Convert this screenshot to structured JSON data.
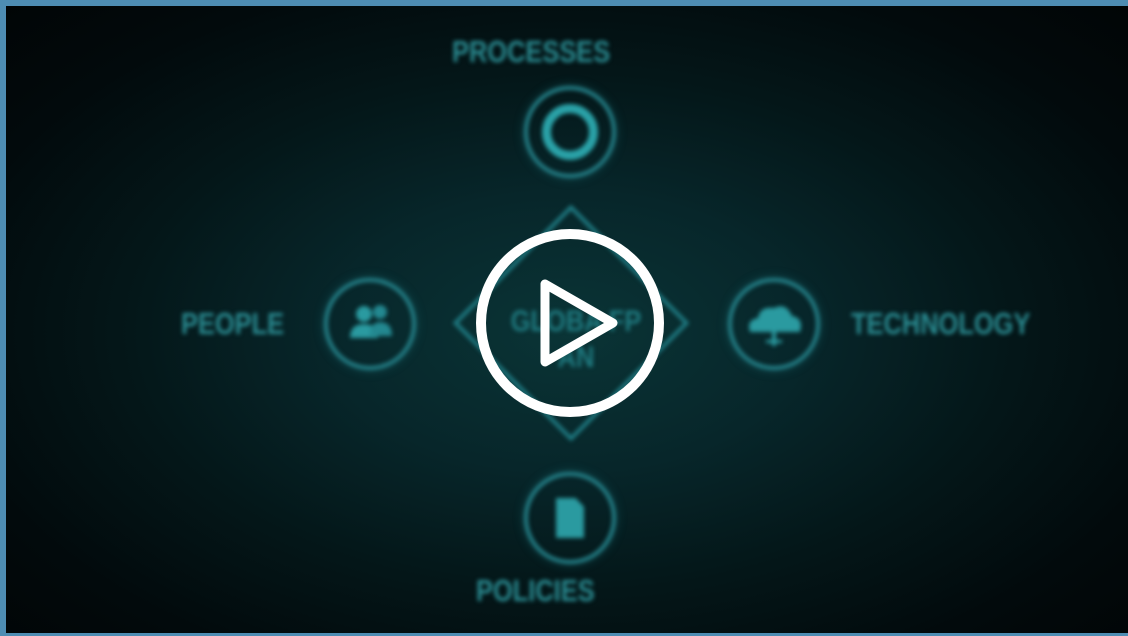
{
  "video": {
    "title_fragments": {
      "line1": "GLOBA  FP",
      "line2": "AN"
    },
    "nodes": {
      "top": "PROCESSES",
      "bottom": "POLICIES",
      "left": "PEOPLE",
      "right": "TECHNOLOGY"
    },
    "icons": {
      "top": "donut-icon",
      "bottom": "document-icon",
      "left": "people-icon",
      "right": "cloud-icon"
    },
    "colors": {
      "frame": "#4e8db3",
      "accent": "#2a8b91",
      "play_button": "#ffffff"
    }
  },
  "controls": {
    "play_icon": "play-icon"
  }
}
